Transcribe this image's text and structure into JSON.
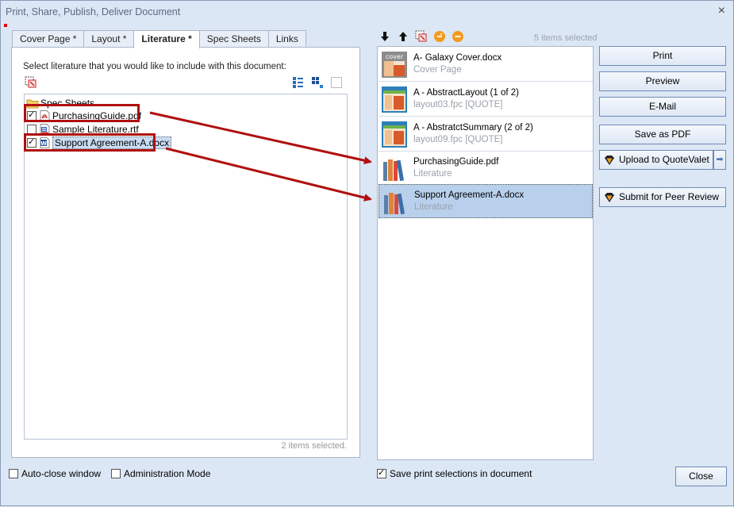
{
  "window": {
    "title": "Print, Share, Publish, Deliver Document",
    "close_glyph": "×"
  },
  "tabs": [
    {
      "label": "Cover Page *",
      "active": false
    },
    {
      "label": "Layout *",
      "active": false
    },
    {
      "label": "Literature *",
      "active": true
    },
    {
      "label": "Spec Sheets",
      "active": false
    },
    {
      "label": "Links",
      "active": false
    }
  ],
  "literature": {
    "instruction": "Select literature that you would like to include with this document:",
    "folder": "Spec Sheets",
    "files": [
      {
        "name": "PurchasingGuide.pdf",
        "checked": true,
        "type": "pdf"
      },
      {
        "name": "Sample Literature.rtf",
        "checked": false,
        "type": "rtf"
      },
      {
        "name": "Support Agreement-A.docx",
        "checked": true,
        "type": "docx"
      }
    ],
    "status": "2 items selected."
  },
  "selection": {
    "count_label": "5 items selected",
    "items": [
      {
        "name": "A- Galaxy Cover.docx",
        "sub": "Cover Page",
        "thumb": "cover"
      },
      {
        "name": "A - AbstractLayout (1 of 2)",
        "sub": "layout03.fpc [QUOTE]",
        "thumb": "layout"
      },
      {
        "name": "A - AbstratctSummary (2 of 2)",
        "sub": "layout09.fpc [QUOTE]",
        "thumb": "layout"
      },
      {
        "name": "PurchasingGuide.pdf",
        "sub": "Literature",
        "thumb": "books"
      },
      {
        "name": "Support Agreement-A.docx",
        "sub": "Literature",
        "thumb": "books",
        "selected": true
      }
    ],
    "cover_thumb_text": "cover"
  },
  "actions": {
    "print": "Print",
    "preview": "Preview",
    "email": "E-Mail",
    "save_pdf": "Save as PDF",
    "upload": "Upload to QuoteValet",
    "peer_review": "Submit for Peer Review"
  },
  "footer": {
    "auto_close": "Auto-close window",
    "admin_mode": "Administration Mode",
    "save_selections": "Save print selections in document",
    "close": "Close"
  },
  "colors": {
    "accent_red": "#b01010",
    "selection_blue": "#b8d0ec"
  }
}
